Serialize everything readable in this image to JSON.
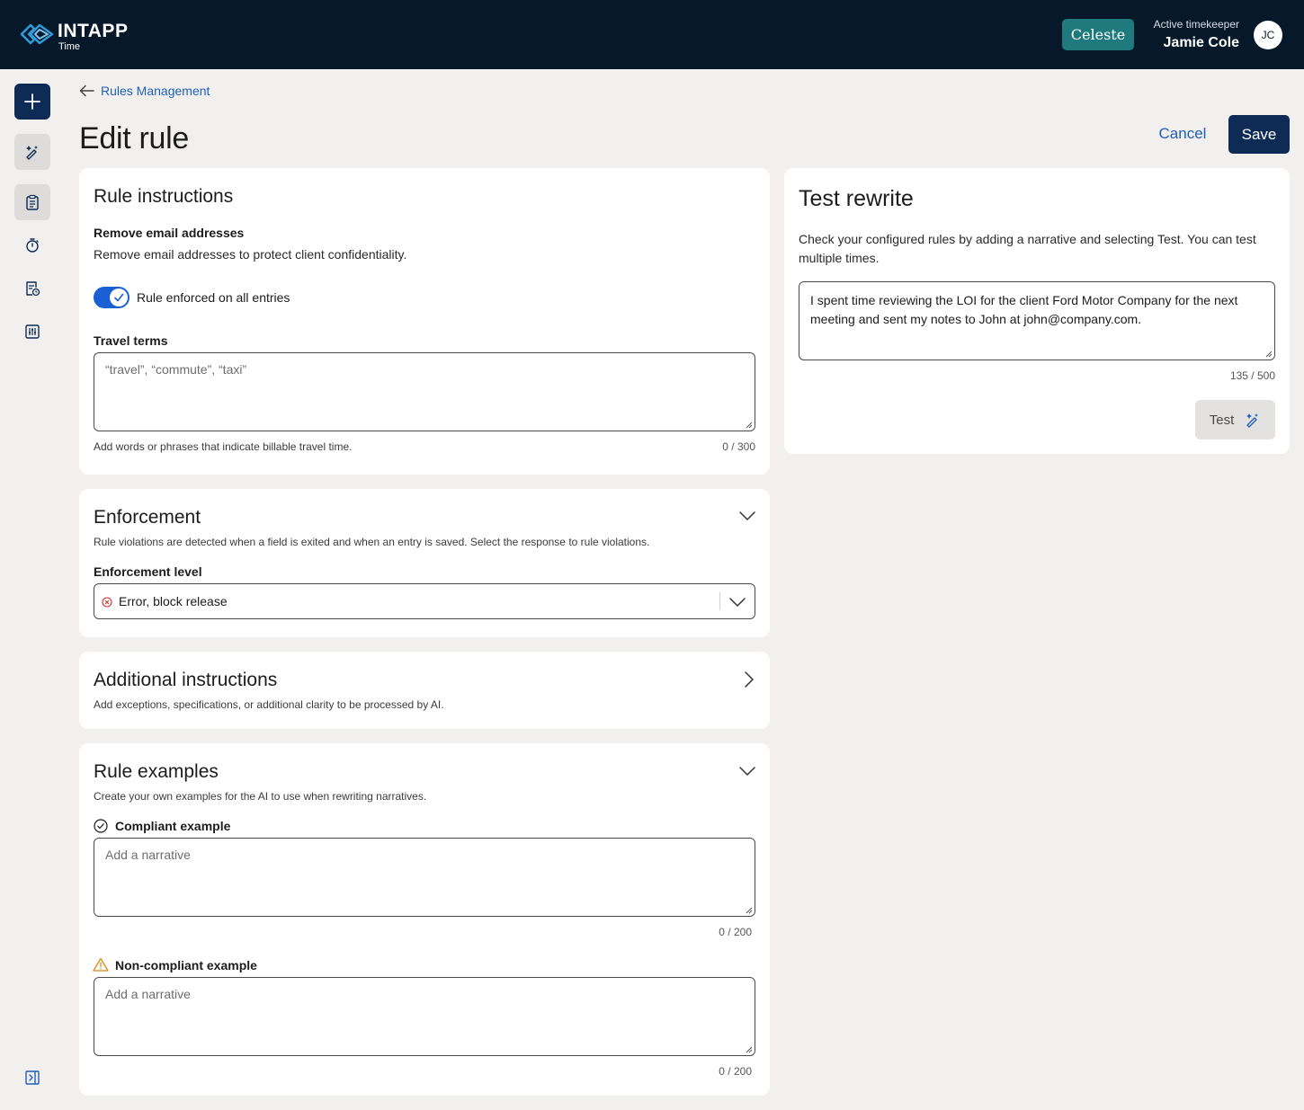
{
  "header": {
    "brand": "INTAPP",
    "product": "Time",
    "assistant_button": "Celeste",
    "timekeeper_label": "Active timekeeper",
    "timekeeper_name": "Jamie Cole",
    "avatar_initials": "JC",
    "colors": {
      "background": "#07182b",
      "assistant": "#1e7a7c"
    }
  },
  "sidebar": {
    "items": [
      {
        "icon": "plus-icon"
      },
      {
        "icon": "ai-pen-icon"
      },
      {
        "icon": "clipboard-icon",
        "active": true
      },
      {
        "icon": "stopwatch-icon"
      },
      {
        "icon": "report-clock-icon"
      },
      {
        "icon": "sliders-icon"
      },
      {
        "icon": "collapse-panel-icon"
      }
    ]
  },
  "page": {
    "breadcrumb": "Rules Management",
    "title": "Edit rule",
    "cancel_label": "Cancel",
    "save_label": "Save"
  },
  "rule_instructions": {
    "title": "Rule instructions",
    "rule_name": "Remove email addresses",
    "rule_description": "Remove email addresses to protect client confidentiality.",
    "toggle_label": "Rule enforced on all entries",
    "toggle_on": true,
    "travel_terms_label": "Travel terms",
    "travel_terms_placeholder": "“travel”, “commute”, “taxi”",
    "travel_terms_help": "Add words or phrases that indicate billable travel time.",
    "travel_terms_counter": "0 / 300"
  },
  "enforcement": {
    "title": "Enforcement",
    "description": "Rule violations are detected when a field is exited and when an entry is saved. Select the response to rule violations.",
    "level_label": "Enforcement level",
    "level_value": "Error, block release"
  },
  "additional_instructions": {
    "title": "Additional instructions",
    "description": "Add exceptions, specifications, or additional clarity to be processed by AI."
  },
  "rule_examples": {
    "title": "Rule examples",
    "description": "Create your own examples for the AI to use when rewriting narratives.",
    "compliant_label": "Compliant example",
    "compliant_placeholder": "Add a narrative",
    "compliant_counter": "0 / 200",
    "noncompliant_label": "Non-compliant example",
    "noncompliant_placeholder": "Add a narrative",
    "noncompliant_counter": "0 / 200"
  },
  "test_rewrite": {
    "title": "Test rewrite",
    "description": "Check your configured rules by adding a narrative and selecting Test. You can test multiple times.",
    "narrative": "I spent time reviewing the LOI for the client Ford Motor Company for the next meeting and sent my notes to John at john@company.com.",
    "counter": "135 / 500",
    "test_label": "Test"
  }
}
